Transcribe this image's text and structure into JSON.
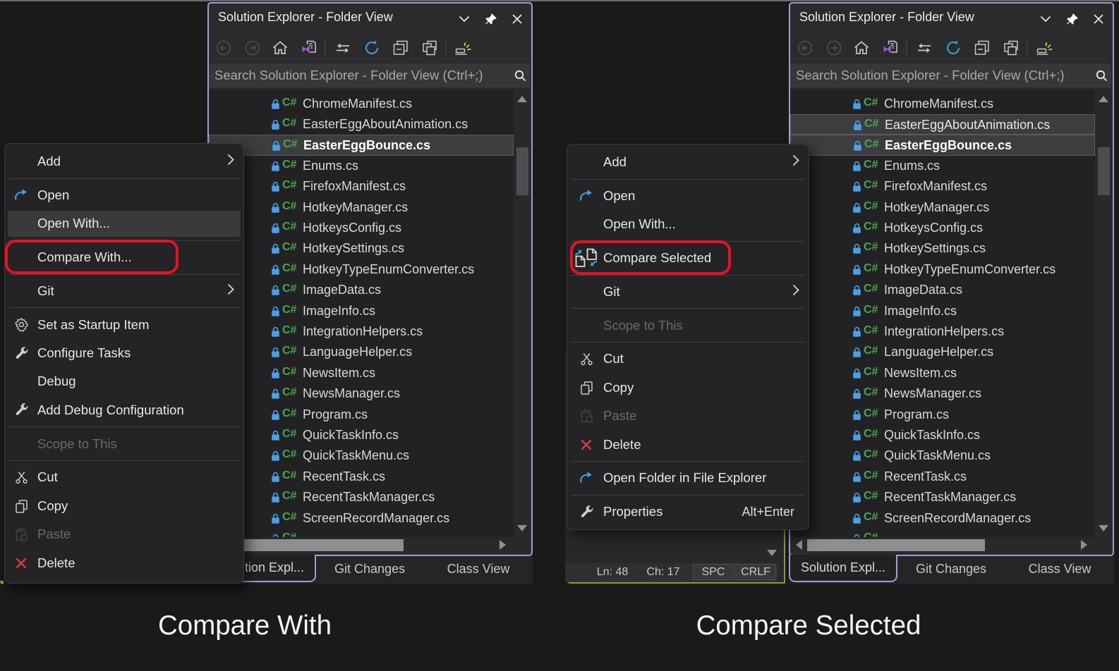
{
  "window": {
    "title": "Solution Explorer - Folder View",
    "search_placeholder": "Search Solution Explorer - Folder View (Ctrl+;)",
    "title_buttons": [
      "window-position",
      "pin",
      "close"
    ]
  },
  "toolbar": [
    {
      "icon": "back"
    },
    {
      "icon": "forward"
    },
    {
      "icon": "home"
    },
    {
      "icon": "sync-active-document"
    },
    {
      "icon": "separator"
    },
    {
      "icon": "switch-views"
    },
    {
      "icon": "refresh"
    },
    {
      "icon": "collapse-all"
    },
    {
      "icon": "show-all-files"
    },
    {
      "icon": "separator"
    },
    {
      "icon": "track-active-item"
    }
  ],
  "files": [
    {
      "name": "ChromeManifest.cs"
    },
    {
      "name": "EasterEggAboutAnimation.cs",
      "selected_in": "right"
    },
    {
      "name": "EasterEggBounce.cs",
      "selected_in": "both",
      "bold": true
    },
    {
      "name": "Enums.cs"
    },
    {
      "name": "FirefoxManifest.cs"
    },
    {
      "name": "HotkeyManager.cs"
    },
    {
      "name": "HotkeysConfig.cs"
    },
    {
      "name": "HotkeySettings.cs"
    },
    {
      "name": "HotkeyTypeEnumConverter.cs"
    },
    {
      "name": "ImageData.cs"
    },
    {
      "name": "ImageInfo.cs"
    },
    {
      "name": "IntegrationHelpers.cs"
    },
    {
      "name": "LanguageHelper.cs"
    },
    {
      "name": "NewsItem.cs"
    },
    {
      "name": "NewsManager.cs"
    },
    {
      "name": "Program.cs"
    },
    {
      "name": "QuickTaskInfo.cs"
    },
    {
      "name": "QuickTaskMenu.cs"
    },
    {
      "name": "RecentTask.cs"
    },
    {
      "name": "RecentTaskManager.cs"
    },
    {
      "name": "ScreenRecordManager.cs"
    },
    {
      "name": "",
      "partial": true
    }
  ],
  "tabs": [
    "Solution Expl...",
    "Git Changes",
    "Class View"
  ],
  "menus": {
    "left": {
      "items": [
        {
          "label": "Add",
          "submenu": true
        },
        {
          "sep": true
        },
        {
          "label": "Open",
          "icon": "open"
        },
        {
          "label": "Open With...",
          "hover": true
        },
        {
          "sep": true
        },
        {
          "label": "Compare With...",
          "annotated": true
        },
        {
          "sep": true
        },
        {
          "label": "Git",
          "submenu": true
        },
        {
          "sep": true
        },
        {
          "label": "Set as Startup Item",
          "icon": "gear"
        },
        {
          "label": "Configure Tasks",
          "icon": "wrench"
        },
        {
          "label": "Debug"
        },
        {
          "label": "Add Debug Configuration",
          "icon": "wrench"
        },
        {
          "sep": true
        },
        {
          "label": "Scope to This",
          "disabled": true
        },
        {
          "sep": true
        },
        {
          "label": "Cut",
          "icon": "cut"
        },
        {
          "label": "Copy",
          "icon": "copy"
        },
        {
          "label": "Paste",
          "icon": "paste",
          "disabled": true
        },
        {
          "label": "Delete",
          "icon": "delete"
        }
      ]
    },
    "right": {
      "items": [
        {
          "label": "Add",
          "submenu": true
        },
        {
          "sep": true
        },
        {
          "label": "Open",
          "icon": "open"
        },
        {
          "label": "Open With..."
        },
        {
          "sep": true
        },
        {
          "label": "Compare Selected",
          "icon": "compare",
          "annotated": true
        },
        {
          "sep": true
        },
        {
          "label": "Git",
          "submenu": true
        },
        {
          "sep": true
        },
        {
          "label": "Scope to This",
          "disabled": true
        },
        {
          "sep": true
        },
        {
          "label": "Cut",
          "icon": "cut"
        },
        {
          "label": "Copy",
          "icon": "copy"
        },
        {
          "label": "Paste",
          "icon": "paste",
          "disabled": true
        },
        {
          "label": "Delete",
          "icon": "delete"
        },
        {
          "sep": true
        },
        {
          "label": "Open Folder in File Explorer",
          "icon": "open"
        },
        {
          "sep": true
        },
        {
          "label": "Properties",
          "icon": "wrench",
          "shortcut": "Alt+Enter"
        }
      ]
    }
  },
  "editor_status": {
    "line": "Ln: 48",
    "column": "Ch: 17",
    "indent": "SPC",
    "line_ending": "CRLF"
  },
  "captions": {
    "left": "Compare With",
    "right": "Compare Selected"
  },
  "colors": {
    "panel_border": "#a79ad1",
    "annotation_red": "#e81123",
    "editor_border_green": "#75a43c",
    "icon_blue": "#4aa0e0",
    "csharp_green": "#4aa64f",
    "delete_red": "#e23b41",
    "refresh_blue": "#3f9bdc",
    "vs_purple": "#9b5bd2",
    "spark_yellow": "#e8c33b"
  }
}
